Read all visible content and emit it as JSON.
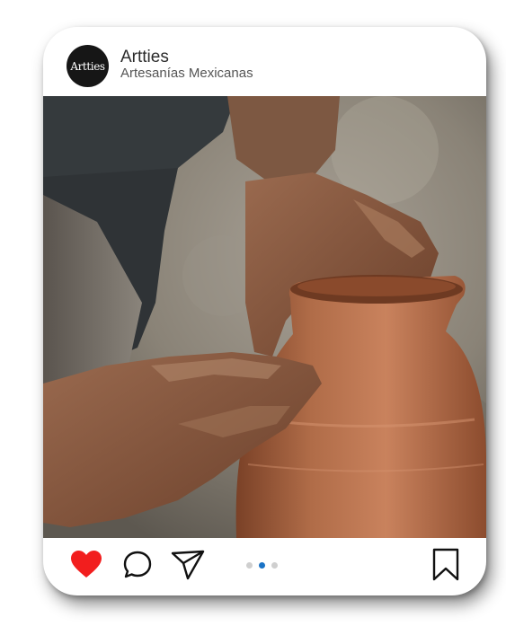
{
  "account": {
    "avatar_text": "Artties",
    "name": "Artties",
    "subtitle": "Artesanías Mexicanas"
  },
  "post": {
    "image_alt_icon": "pottery-photo",
    "carousel": {
      "count": 3,
      "active_index": 1
    },
    "actions": {
      "like_icon": "heart-icon",
      "like_color": "#f21e1e",
      "comment_icon": "comment-bubble-icon",
      "share_icon": "paper-plane-icon",
      "save_icon": "bookmark-icon",
      "carousel_active_color": "#1a73c6"
    }
  }
}
